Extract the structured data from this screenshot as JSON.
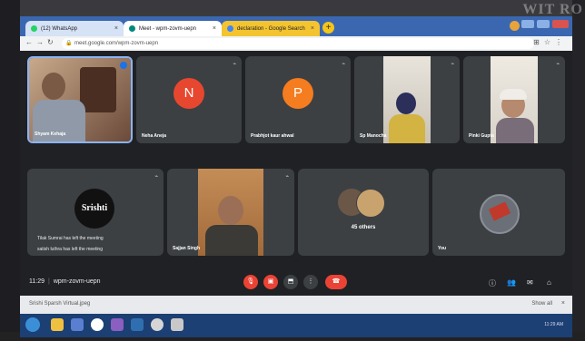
{
  "browser": {
    "tabs": [
      {
        "label": "(12) WhatsApp",
        "favicon_color": "#25d366"
      },
      {
        "label": "Meet - wpm-zovm-uepn",
        "favicon_color": "#00897b"
      },
      {
        "label": "declaration - Google Search",
        "favicon_color": "#4285f4"
      }
    ],
    "address": "meet.google.com/wpm-zovm-uepn"
  },
  "overlay_text": "WIT RO",
  "participants": [
    {
      "name": "Shyam Kehaja",
      "type": "video"
    },
    {
      "name": "Neha Aneja",
      "type": "avatar",
      "initial": "N",
      "color": "#e8472f"
    },
    {
      "name": "Prabhjot kaur ahwal",
      "type": "avatar",
      "initial": "P",
      "color": "#f57c1f"
    },
    {
      "name": "Sp Manocha",
      "type": "video"
    },
    {
      "name": "Pinki Gupta",
      "type": "video"
    },
    {
      "name": "Srishti",
      "type": "logo"
    },
    {
      "name": "Sajjan Singh",
      "type": "video"
    },
    {
      "name": "45 others",
      "type": "others"
    },
    {
      "name": "You",
      "type": "self"
    }
  ],
  "notifications": [
    "Tilak Sumrai has left the meeting",
    "satish luthra has left the meeting"
  ],
  "meeting": {
    "time": "11:29",
    "code": "wpm-zovm-uepn"
  },
  "download": {
    "file": "Srishi Sparsh Virtual.jpeg",
    "show_all": "Show all"
  },
  "taskbar": {
    "clock": "11:29 AM"
  },
  "colors": {
    "meet_bg": "#202124",
    "tile_bg": "#3c4043",
    "danger": "#ea4335"
  }
}
